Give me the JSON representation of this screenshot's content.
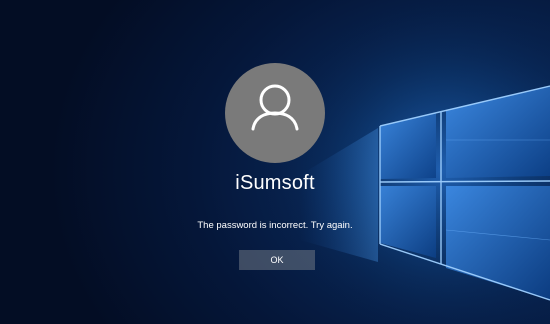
{
  "login": {
    "username": "iSumsoft",
    "error_message": "The password is incorrect. Try again.",
    "ok_label": "OK"
  },
  "colors": {
    "background": "#05173a",
    "avatar": "#7a7a7a",
    "text": "#ffffff",
    "button": "#6e7684"
  },
  "icons": {
    "avatar": "user-icon",
    "wallpaper": "windows-logo"
  }
}
